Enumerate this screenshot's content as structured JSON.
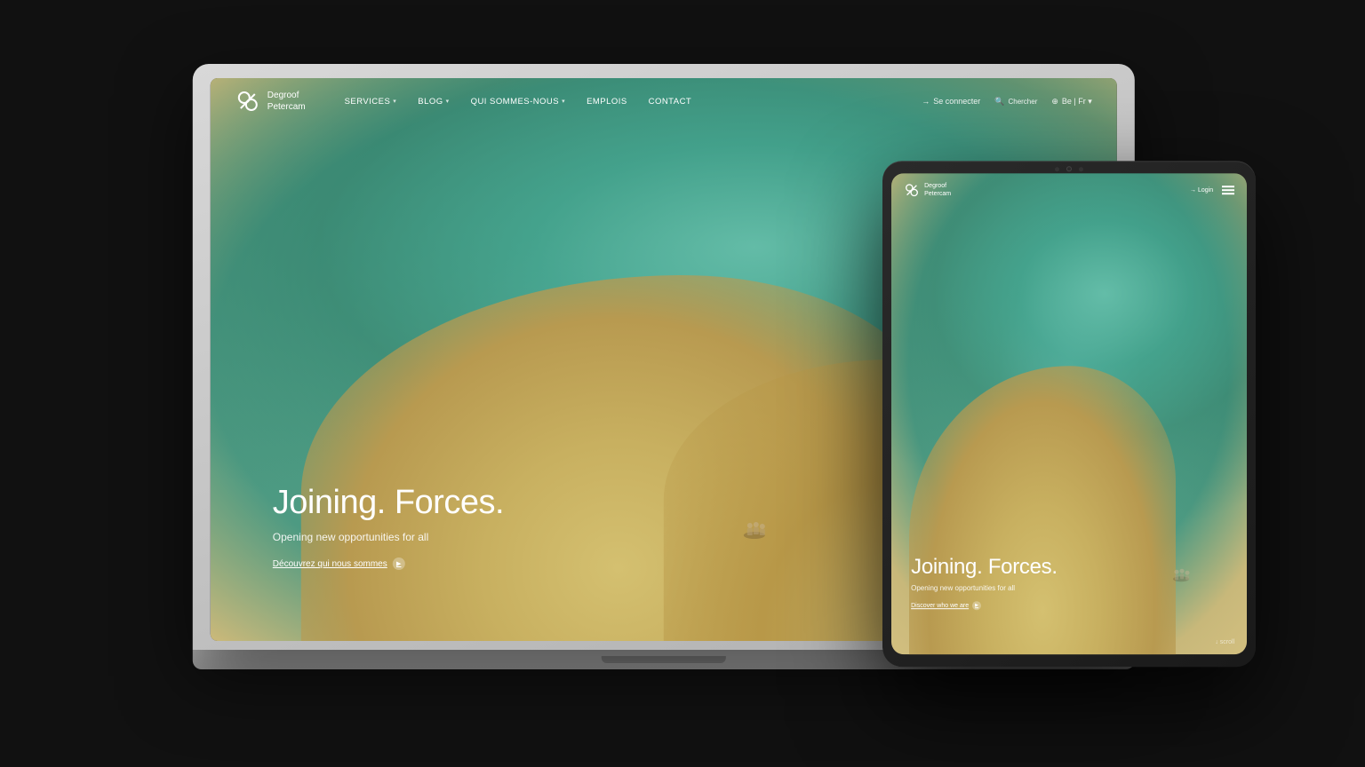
{
  "laptop": {
    "navbar": {
      "logo_name": "Degroof",
      "logo_name2": "Petercam",
      "nav_items": [
        {
          "label": "SERVICES",
          "has_dropdown": true
        },
        {
          "label": "BLOG",
          "has_dropdown": true
        },
        {
          "label": "QUI SOMMES-NOUS",
          "has_dropdown": true
        },
        {
          "label": "EMPLOIS",
          "has_dropdown": false
        },
        {
          "label": "CONTACT",
          "has_dropdown": false
        }
      ],
      "right_items": [
        {
          "label": "Se connecter",
          "icon": "login-icon"
        },
        {
          "label": "Chercher",
          "icon": "search-icon"
        },
        {
          "label": "Be | Fr ▾",
          "icon": "globe-icon"
        }
      ]
    },
    "hero": {
      "title": "Joining. Forces.",
      "subtitle": "Opening new opportunities for all",
      "cta_label": "Découvrez qui nous sommes"
    }
  },
  "tablet": {
    "navbar": {
      "logo_name": "Degroof",
      "logo_name2": "Petercam",
      "login_label": "Login"
    },
    "hero": {
      "title": "Joining. Forces.",
      "subtitle": "Opening new opportunities for all",
      "cta_label": "Discover who we are"
    }
  },
  "colors": {
    "teal": "#6dc8b0",
    "sand": "#c8b060",
    "white": "#ffffff",
    "dark": "#1a1a1a"
  }
}
